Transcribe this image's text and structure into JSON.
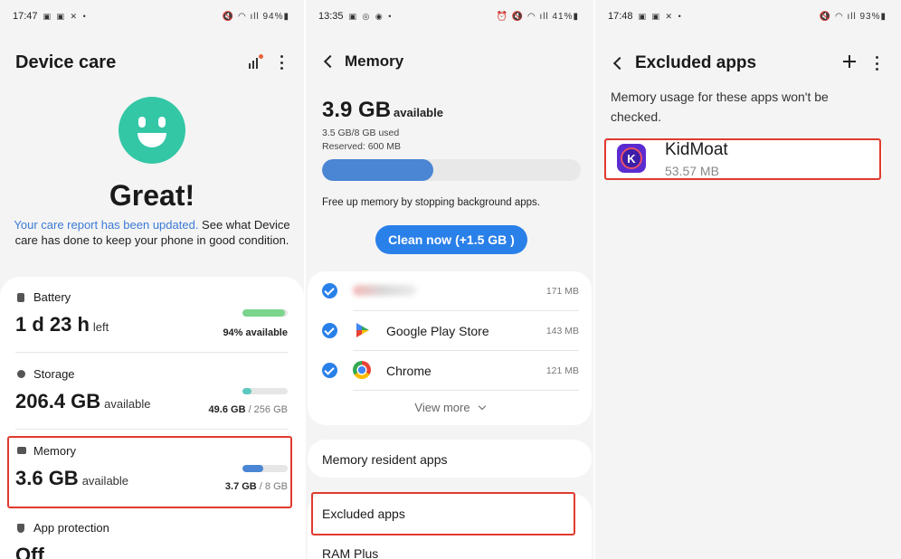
{
  "device_care": {
    "status_time": "17:47",
    "status_right": "94%",
    "title": "Device care",
    "headline": "Great!",
    "report_link": "Your care report has been updated.",
    "report_text": " See what Device care has done to keep your phone in good condition.",
    "battery": {
      "label": "Battery",
      "value": "1 d 23 h",
      "unit": "left",
      "detail": "94% available",
      "level": 0.94,
      "color": "#7bd48c"
    },
    "storage": {
      "label": "Storage",
      "value": "206.4 GB",
      "unit": "available",
      "detail_used": "49.6 GB",
      "detail_total": " / 256 GB",
      "level": 0.19,
      "color": "#5cc9c0"
    },
    "memory": {
      "label": "Memory",
      "value": "3.6 GB",
      "unit": "available",
      "detail_used": "3.7 GB",
      "detail_total": " / 8 GB",
      "level": 0.46,
      "color": "#4a86d4"
    },
    "app_protection": {
      "label": "App protection",
      "value": "Off"
    }
  },
  "memory": {
    "status_time": "13:35",
    "status_right": "41%",
    "title": "Memory",
    "available_value": "3.9 GB",
    "available_unit": "available",
    "used_text": "3.5 GB/8 GB used",
    "reserved_text": "Reserved: 600 MB",
    "used_fraction": 0.43,
    "free_up_text": "Free up memory by stopping background apps.",
    "clean_button": "Clean now (+1.5 GB )",
    "apps": [
      {
        "name": "",
        "size": "171 MB"
      },
      {
        "name": "Google Play Store",
        "size": "143 MB"
      },
      {
        "name": "Chrome",
        "size": "121 MB"
      }
    ],
    "view_more": "View more",
    "resident_apps": "Memory resident apps",
    "excluded_apps": "Excluded apps",
    "ram_plus": "RAM Plus"
  },
  "excluded": {
    "status_time": "17:48",
    "status_right": "93%",
    "title": "Excluded apps",
    "description": "Memory usage for these apps won't be checked.",
    "app_name": "KidMoat",
    "app_size": "53.57 MB",
    "app_icon_letter": "K"
  },
  "colors": {
    "accent": "#2a80e9",
    "highlight": "#e03a2f",
    "face": "#33c7a6"
  }
}
